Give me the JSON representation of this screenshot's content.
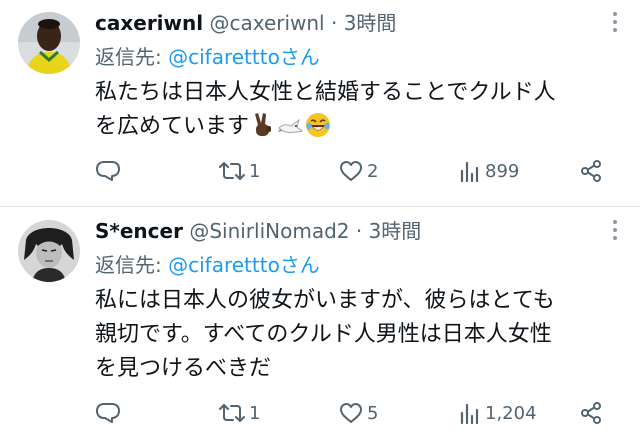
{
  "posts": [
    {
      "name": "caxeriwnl",
      "handle": "@caxeriwnl",
      "separator": "·",
      "time": "3時間",
      "reply_prefix": "返信先: ",
      "reply_to": "@cifaretttoさん",
      "text_lines": [
        "私たちは日本人女性と結婚することでクルド人",
        "を広めています"
      ],
      "emojis": [
        "victory-hand-icon",
        "dove-icon",
        "laughing-emoji-icon"
      ],
      "replies": "",
      "reposts": "1",
      "likes": "2",
      "views": "899"
    },
    {
      "name": "S*encer",
      "handle": "@SinirliNomad2",
      "separator": "·",
      "time": "3時間",
      "reply_prefix": "返信先: ",
      "reply_to": "@cifaretttoさん",
      "text_lines": [
        "私には日本人の彼女がいますが、彼らはとても",
        "親切です。すべてのクルド人男性は日本人女性",
        "を見つけるべきだ"
      ],
      "replies": "",
      "reposts": "1",
      "likes": "5",
      "views": "1,204"
    }
  ],
  "colors": {
    "link": "#1d9bf0",
    "muted": "#536471",
    "text": "#0f1419",
    "divider": "#e6e9ec"
  }
}
